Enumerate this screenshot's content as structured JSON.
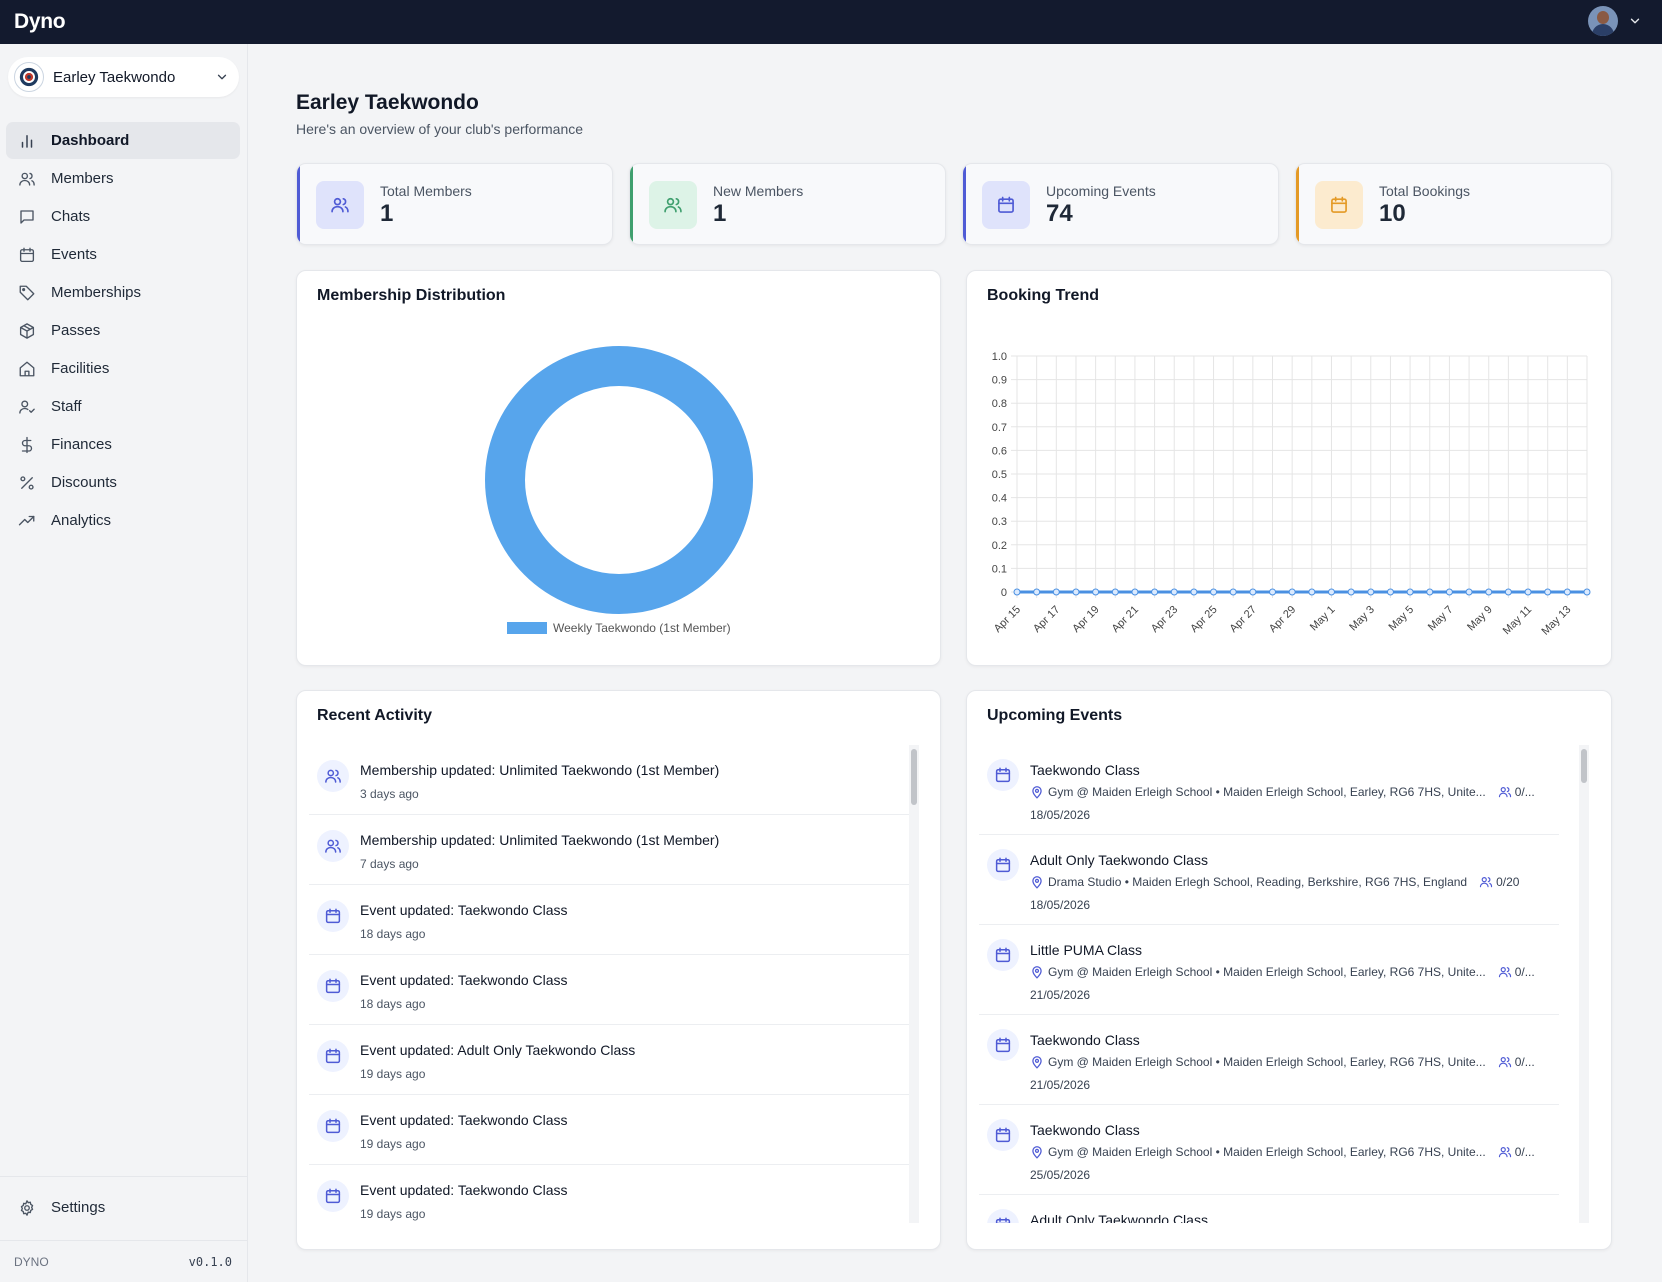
{
  "app": {
    "brand": "Dyno"
  },
  "sidebar": {
    "club_name": "Earley Taekwondo",
    "items": [
      {
        "label": "Dashboard",
        "icon": "bar-chart-icon"
      },
      {
        "label": "Members",
        "icon": "users-icon"
      },
      {
        "label": "Chats",
        "icon": "chat-icon"
      },
      {
        "label": "Events",
        "icon": "calendar-icon"
      },
      {
        "label": "Memberships",
        "icon": "tag-icon"
      },
      {
        "label": "Passes",
        "icon": "package-icon"
      },
      {
        "label": "Facilities",
        "icon": "home-icon"
      },
      {
        "label": "Staff",
        "icon": "user-check-icon"
      },
      {
        "label": "Finances",
        "icon": "dollar-icon"
      },
      {
        "label": "Discounts",
        "icon": "percent-icon"
      },
      {
        "label": "Analytics",
        "icon": "trending-up-icon"
      }
    ],
    "active": "Dashboard",
    "settings_label": "Settings",
    "footer_brand": "DYNO",
    "version": "v0.1.0"
  },
  "header": {
    "title": "Earley Taekwondo",
    "subtitle": "Here's an overview of your club's performance"
  },
  "stats": [
    {
      "label": "Total Members",
      "value": "1",
      "accent": "#4f5bd5",
      "bg": "#dfe3fb",
      "icon": "users-icon"
    },
    {
      "label": "New Members",
      "value": "1",
      "accent": "#3f9f6e",
      "bg": "#ddf3e7",
      "icon": "user-plus-icon"
    },
    {
      "label": "Upcoming Events",
      "value": "74",
      "accent": "#4f5bd5",
      "bg": "#dfe3fb",
      "icon": "calendar-icon"
    },
    {
      "label": "Total Bookings",
      "value": "10",
      "accent": "#e49a26",
      "bg": "#fcebcf",
      "icon": "calendar-icon"
    }
  ],
  "membership_card": {
    "title": "Membership Distribution"
  },
  "booking_card": {
    "title": "Booking Trend"
  },
  "chart_data": [
    {
      "type": "pie",
      "labels": [
        "Weekly Taekwondo (1st Member)"
      ],
      "values": [
        1
      ],
      "colors": [
        "#57a5ec"
      ],
      "legend": "bottom"
    },
    {
      "type": "line",
      "x": [
        "Apr 15",
        "Apr 16",
        "Apr 17",
        "Apr 18",
        "Apr 19",
        "Apr 20",
        "Apr 21",
        "Apr 22",
        "Apr 23",
        "Apr 24",
        "Apr 25",
        "Apr 26",
        "Apr 27",
        "Apr 28",
        "Apr 29",
        "Apr 30",
        "May 1",
        "May 2",
        "May 3",
        "May 4",
        "May 5",
        "May 6",
        "May 7",
        "May 8",
        "May 9",
        "May 10",
        "May 11",
        "May 12",
        "May 13",
        "May 14"
      ],
      "x_tick_labels": [
        "Apr 15",
        "Apr 17",
        "Apr 19",
        "Apr 21",
        "Apr 23",
        "Apr 25",
        "Apr 27",
        "Apr 29",
        "May 1",
        "May 3",
        "May 5",
        "May 7",
        "May 9",
        "May 11",
        "May 13"
      ],
      "series": [
        {
          "values": [
            0,
            0,
            0,
            0,
            0,
            0,
            0,
            0,
            0,
            0,
            0,
            0,
            0,
            0,
            0,
            0,
            0,
            0,
            0,
            0,
            0,
            0,
            0,
            0,
            0,
            0,
            0,
            0,
            0,
            0
          ],
          "color": "#4a90e2"
        }
      ],
      "y_ticks": [
        "0",
        "0.1",
        "0.2",
        "0.3",
        "0.4",
        "0.5",
        "0.6",
        "0.7",
        "0.8",
        "0.9",
        "1.0"
      ],
      "ylim": [
        0,
        1
      ],
      "grid": true
    }
  ],
  "recent_activity": {
    "title": "Recent Activity",
    "items": [
      {
        "title": "Membership updated: Unlimited Taekwondo (1st Member)",
        "time": "3 days ago",
        "icon": "users-icon"
      },
      {
        "title": "Membership updated: Unlimited Taekwondo (1st Member)",
        "time": "7 days ago",
        "icon": "users-icon"
      },
      {
        "title": "Event updated: Taekwondo Class",
        "time": "18 days ago",
        "icon": "calendar-icon"
      },
      {
        "title": "Event updated: Taekwondo Class",
        "time": "18 days ago",
        "icon": "calendar-icon"
      },
      {
        "title": "Event updated: Adult Only Taekwondo Class",
        "time": "19 days ago",
        "icon": "calendar-icon"
      },
      {
        "title": "Event updated: Taekwondo Class",
        "time": "19 days ago",
        "icon": "calendar-icon"
      },
      {
        "title": "Event updated: Taekwondo Class",
        "time": "19 days ago",
        "icon": "calendar-icon"
      }
    ]
  },
  "upcoming_events": {
    "title": "Upcoming Events",
    "items": [
      {
        "title": "Taekwondo Class",
        "location": "Gym @ Maiden Erleigh School • Maiden Erleigh School, Earley, RG6 7HS, Unite...",
        "capacity": "0/...",
        "date": "18/05/2026"
      },
      {
        "title": "Adult Only Taekwondo Class",
        "location": "Drama Studio • Maiden Erlegh School, Reading, Berkshire, RG6 7HS, England",
        "capacity": "0/20",
        "date": "18/05/2026"
      },
      {
        "title": "Little PUMA Class",
        "location": "Gym @ Maiden Erleigh School • Maiden Erleigh School, Earley, RG6 7HS, Unite...",
        "capacity": "0/...",
        "date": "21/05/2026"
      },
      {
        "title": "Taekwondo Class",
        "location": "Gym @ Maiden Erleigh School • Maiden Erleigh School, Earley, RG6 7HS, Unite...",
        "capacity": "0/...",
        "date": "21/05/2026"
      },
      {
        "title": "Taekwondo Class",
        "location": "Gym @ Maiden Erleigh School • Maiden Erleigh School, Earley, RG6 7HS, Unite...",
        "capacity": "0/...",
        "date": "25/05/2026"
      },
      {
        "title": "Adult Only Taekwondo Class",
        "location": "",
        "capacity": "",
        "date": ""
      }
    ]
  }
}
